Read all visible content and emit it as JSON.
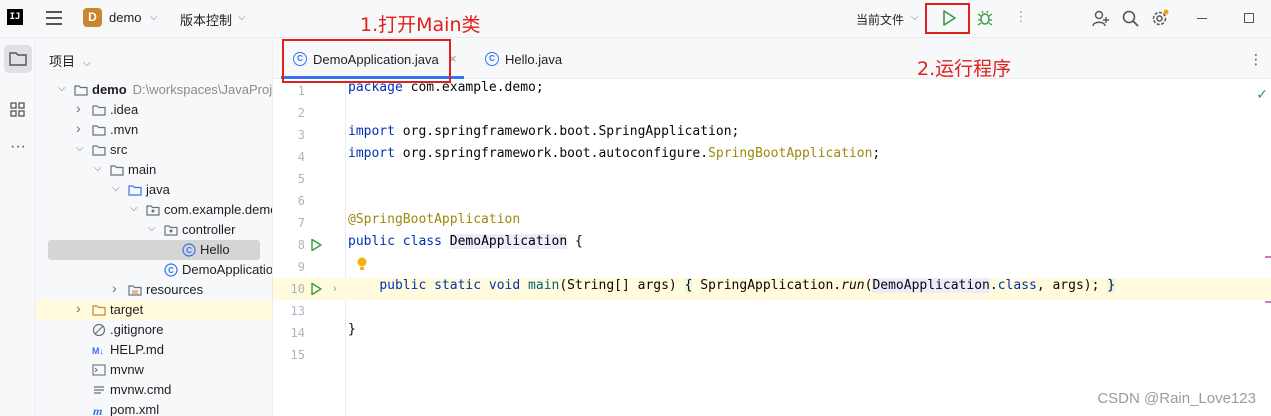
{
  "topbar": {
    "app_icon_label": "IJ",
    "project_badge": "D",
    "project_name": "demo",
    "vcs_label": "版本控制",
    "run_config": "当前文件",
    "icons": [
      "hamburger-menu-icon",
      "run-icon",
      "debug-icon",
      "add-user-icon",
      "search-icon",
      "settings-icon",
      "minimize-icon",
      "maximize-icon"
    ]
  },
  "annotations": {
    "step1": "1.打开Main类",
    "step2": "2.运行程序"
  },
  "panel": {
    "title": "项目",
    "tree": [
      {
        "label": "demo",
        "path": "D:\\workspaces\\JavaProje",
        "bold": true,
        "depth": 0,
        "expanded": true,
        "icon": "module-folder-icon"
      },
      {
        "label": ".idea",
        "depth": 1,
        "expanded": false,
        "icon": "folder-icon"
      },
      {
        "label": ".mvn",
        "depth": 1,
        "expanded": false,
        "icon": "folder-icon"
      },
      {
        "label": "src",
        "depth": 1,
        "expanded": true,
        "icon": "folder-icon"
      },
      {
        "label": "main",
        "depth": 2,
        "expanded": true,
        "icon": "folder-icon"
      },
      {
        "label": "java",
        "depth": 3,
        "expanded": true,
        "icon": "source-folder-icon"
      },
      {
        "label": "com.example.demo",
        "depth": 4,
        "expanded": true,
        "icon": "package-icon"
      },
      {
        "label": "controller",
        "depth": 5,
        "expanded": true,
        "icon": "package-icon"
      },
      {
        "label": "Hello",
        "depth": 6,
        "icon": "class-icon",
        "selected": true
      },
      {
        "label": "DemoApplication",
        "depth": 5,
        "icon": "class-icon"
      },
      {
        "label": "resources",
        "depth": 3,
        "expanded": false,
        "icon": "resources-folder-icon"
      },
      {
        "label": "target",
        "depth": 1,
        "expanded": false,
        "icon": "excluded-folder-icon",
        "highlight": true
      },
      {
        "label": ".gitignore",
        "depth": 1,
        "icon": "gitignore-icon"
      },
      {
        "label": "HELP.md",
        "depth": 1,
        "icon": "markdown-icon"
      },
      {
        "label": "mvnw",
        "depth": 1,
        "icon": "shell-icon"
      },
      {
        "label": "mvnw.cmd",
        "depth": 1,
        "icon": "text-file-icon"
      },
      {
        "label": "pom.xml",
        "depth": 1,
        "icon": "maven-icon"
      }
    ]
  },
  "editor": {
    "tabs": [
      {
        "label": "DemoApplication.java",
        "active": true
      },
      {
        "label": "Hello.java",
        "active": false
      }
    ],
    "line_numbers": [
      "1",
      "2",
      "3",
      "4",
      "5",
      "6",
      "7",
      "8",
      "9",
      "10",
      "13",
      "14",
      "15"
    ],
    "code": {
      "l1": {
        "kw": "package",
        "rest": " com.example.demo;"
      },
      "l3": {
        "kw": "import",
        "rest": " org.springframework.boot.SpringApplication;"
      },
      "l4": {
        "kw": "import",
        "rest": " org.springframework.boot.autoconfigure.",
        "ann": "SpringBootApplication",
        "end": ";"
      },
      "l7": {
        "ann": "@SpringBootApplication"
      },
      "l8": {
        "kw1": "public",
        "kw2": "class",
        "cls": "DemoApplication",
        "end": " {"
      },
      "l10": {
        "kw1": "public",
        "kw2": "static",
        "kw3": "void",
        "method": "main",
        "args": "(String[] args) ",
        "open": "{",
        "cls": "SpringApplication.",
        "run": "run",
        "p1": "(",
        "cls2": "DemoApplication",
        "dot": ".",
        "kw4": "class",
        "p2": ", args); ",
        "close": "}"
      },
      "l14": {
        "text": "}"
      }
    }
  },
  "watermark": "CSDN @Rain_Love123"
}
